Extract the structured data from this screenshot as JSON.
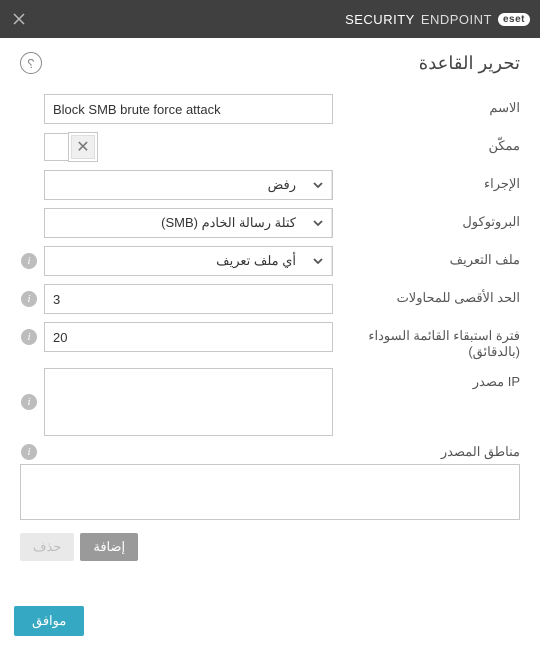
{
  "titlebar": {
    "brand_logo": "eset",
    "brand_thin": "ENDPOINT",
    "brand_bold": "SECURITY"
  },
  "header": {
    "title": "تحرير القاعدة",
    "help_glyph": "?"
  },
  "form": {
    "name_label": "الاسم",
    "name_value": "Block SMB brute force attack",
    "enabled_label": "ممكّن",
    "enabled_checked_glyph": "✕",
    "action_label": "الإجراء",
    "action_value": "رفض",
    "protocol_label": "البروتوكول",
    "protocol_value": "كتلة رسالة الخادم (SMB)",
    "profile_label": "ملف التعريف",
    "profile_value": "أي ملف تعريف",
    "max_attempts_label": "الحد الأقصى للمحاولات",
    "max_attempts_value": "3",
    "blacklist_label": "فترة استبقاء القائمة السوداء (بالدقائق)",
    "blacklist_value": "20",
    "src_ip_label": "IP مصدر",
    "src_ip_value": "",
    "src_zones_label": "مناطق المصدر",
    "src_zones_value": "",
    "add_btn": "إضافة",
    "del_btn": "حذف"
  },
  "footer": {
    "ok": "موافق"
  },
  "info_glyph": "i"
}
